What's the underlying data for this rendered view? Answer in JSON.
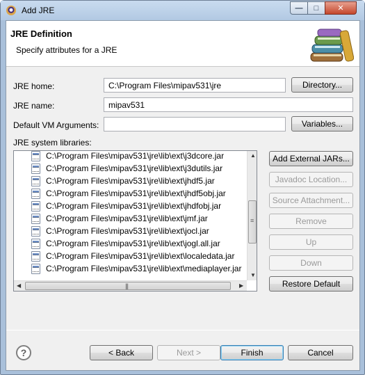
{
  "window": {
    "title": "Add JRE",
    "controls": {
      "minimize": "—",
      "maximize": "□",
      "close": "✕"
    }
  },
  "header": {
    "title": "JRE Definition",
    "subtitle": "Specify attributes for a JRE",
    "icon": "library-books-icon"
  },
  "form": {
    "jre_home_label": "JRE home:",
    "jre_home_value": "C:\\Program Files\\mipav531\\jre",
    "directory_button": "Directory...",
    "jre_name_label": "JRE name:",
    "jre_name_value": "mipav531",
    "vm_args_label": "Default VM Arguments:",
    "vm_args_value": "",
    "variables_button": "Variables...",
    "libraries_label": "JRE system libraries:"
  },
  "libraries": [
    "C:\\Program Files\\mipav531\\jre\\lib\\ext\\j3dcore.jar",
    "C:\\Program Files\\mipav531\\jre\\lib\\ext\\j3dutils.jar",
    "C:\\Program Files\\mipav531\\jre\\lib\\ext\\jhdf5.jar",
    "C:\\Program Files\\mipav531\\jre\\lib\\ext\\jhdf5obj.jar",
    "C:\\Program Files\\mipav531\\jre\\lib\\ext\\jhdfobj.jar",
    "C:\\Program Files\\mipav531\\jre\\lib\\ext\\jmf.jar",
    "C:\\Program Files\\mipav531\\jre\\lib\\ext\\jocl.jar",
    "C:\\Program Files\\mipav531\\jre\\lib\\ext\\jogl.all.jar",
    "C:\\Program Files\\mipav531\\jre\\lib\\ext\\localedata.jar",
    "C:\\Program Files\\mipav531\\jre\\lib\\ext\\mediaplayer.jar"
  ],
  "side_buttons": {
    "add_external_jars": "Add External JARs...",
    "javadoc_location": "Javadoc Location...",
    "source_attachment": "Source Attachment...",
    "remove": "Remove",
    "up": "Up",
    "down": "Down",
    "restore_default": "Restore Default"
  },
  "footer": {
    "help": "?",
    "back": "< Back",
    "next": "Next >",
    "finish": "Finish",
    "cancel": "Cancel"
  },
  "colors": {
    "window_frame": "#a9c0da",
    "dialog_bg": "#f0f0f0",
    "close_button": "#c4472c"
  }
}
